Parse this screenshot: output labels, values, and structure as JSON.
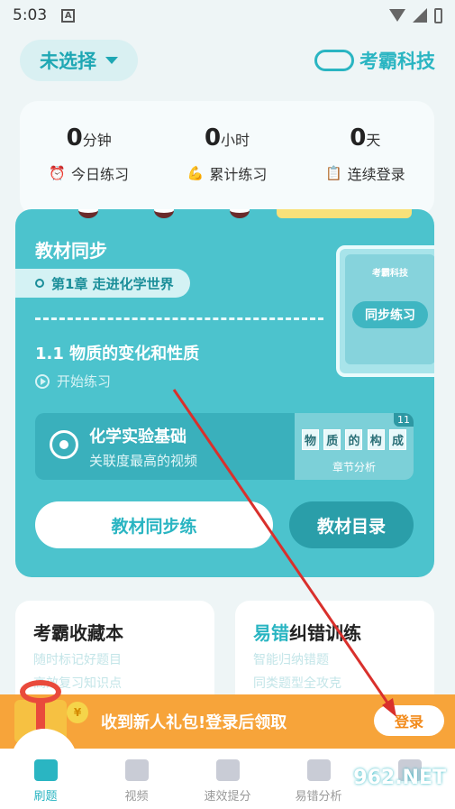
{
  "status_bar": {
    "time": "5:03",
    "a_icon_text": "A"
  },
  "header": {
    "selector_label": "未选择",
    "brand_name": "考霸科技"
  },
  "stats": [
    {
      "value": "0",
      "unit": "分钟",
      "icon": "⏰",
      "label": "今日练习"
    },
    {
      "value": "0",
      "unit": "小时",
      "icon": "💪",
      "label": "累计练习"
    },
    {
      "value": "0",
      "unit": "天",
      "icon": "📋",
      "label": "连续登录"
    }
  ],
  "sync": {
    "title": "教材同步",
    "chapter": "第1章  走进化学世界",
    "lesson": "1.1  物质的变化和性质",
    "start_label": "开始练习",
    "book_brand": "考霸科技",
    "book_button": "同步练习",
    "video": {
      "title": "化学实验基础",
      "subtitle": "关联度最高的视频",
      "thumb_chars": [
        "物",
        "质",
        "的",
        "构",
        "成"
      ],
      "thumb_caption": "章节分析",
      "badge": "11"
    },
    "btn_practice": "教材同步练",
    "btn_catalog": "教材目录"
  },
  "cards": {
    "left": {
      "title_prefix": "考霸",
      "title_accent": "收藏本",
      "line1": "随时标记好题目",
      "line2": "高效复习知识点"
    },
    "right": {
      "title_accent": "易错",
      "title_suffix": "纠错训练",
      "line1": "智能归纳错题",
      "line2": "同类题型全攻克"
    }
  },
  "promo": {
    "text": "收到新人礼包!登录后领取",
    "coin_symbol": "¥",
    "login_label": "登录"
  },
  "tabs": [
    {
      "label": "刷题"
    },
    {
      "label": "视频"
    },
    {
      "label": "速效提分"
    },
    {
      "label": "易错分析"
    },
    {
      "label": ""
    }
  ],
  "watermark": "962.NET",
  "colors": {
    "accent": "#2ab5c2",
    "card": "#4cc3cd",
    "promo": "#f7a43a",
    "arrow": "#d9302c"
  }
}
